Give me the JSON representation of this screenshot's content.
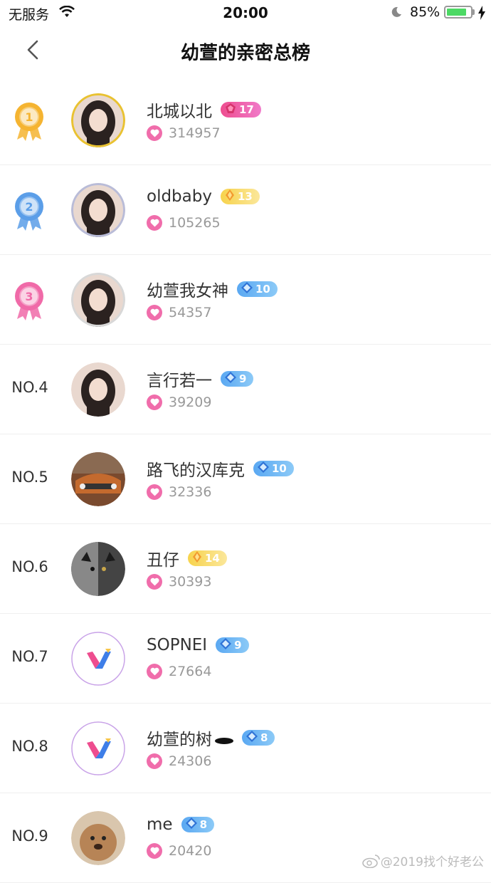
{
  "status_bar": {
    "carrier": "无服务",
    "time": "20:00",
    "battery_percent": "85%",
    "battery_level": 0.85
  },
  "nav": {
    "title": "幼萱的亲密总榜"
  },
  "rankings": [
    {
      "rank": "1",
      "name": "北城以北",
      "badge_level": "17",
      "badge_type": "pink",
      "score": "314957",
      "medal_color": "#f5b431",
      "avatar": "girl-portrait"
    },
    {
      "rank": "2",
      "name": "oldbaby",
      "badge_level": "13",
      "badge_type": "gold",
      "score": "105265",
      "medal_color": "#5b9ee8",
      "avatar": "girl-portrait"
    },
    {
      "rank": "3",
      "name": "幼萱我女神",
      "badge_level": "10",
      "badge_type": "blue",
      "score": "54357",
      "medal_color": "#f06aa8",
      "avatar": "girl-portrait"
    },
    {
      "rank": "NO.4",
      "name": "言行若一",
      "badge_level": "9",
      "badge_type": "blue",
      "score": "39209",
      "avatar": "girl-portrait"
    },
    {
      "rank": "NO.5",
      "name": "路飞的汉库克",
      "badge_level": "10",
      "badge_type": "blue",
      "score": "32336",
      "avatar": "car-photo"
    },
    {
      "rank": "NO.6",
      "name": "丑仔",
      "badge_level": "14",
      "badge_type": "gold",
      "score": "30393",
      "avatar": "cat-photo"
    },
    {
      "rank": "NO.7",
      "name": "SOPNEI",
      "badge_level": "9",
      "badge_type": "blue",
      "score": "27664",
      "avatar": "v-logo"
    },
    {
      "rank": "NO.8",
      "name": "幼萱的树",
      "badge_level": "8",
      "badge_type": "blue",
      "score": "24306",
      "avatar": "v-logo",
      "name_suffix_icon": "black-stone-icon"
    },
    {
      "rank": "NO.9",
      "name": "me",
      "badge_level": "8",
      "badge_type": "blue",
      "score": "20420",
      "avatar": "dog-photo"
    }
  ],
  "watermark": "@2019找个好老公",
  "colors": {
    "heart": "#f06dab",
    "badge_blue": "#5aa8f2",
    "badge_gold": "#f7d34c",
    "badge_pink": "#ee4d8f"
  }
}
